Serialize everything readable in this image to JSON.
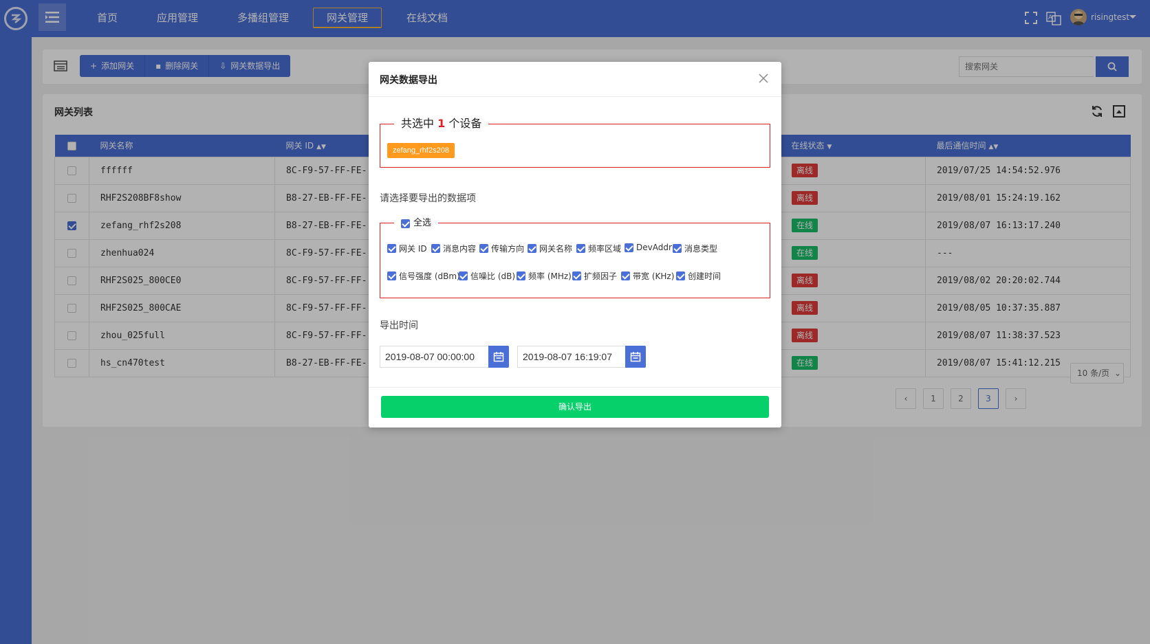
{
  "nav": {
    "items": [
      "首页",
      "应用管理",
      "多播组管理",
      "网关管理",
      "在线文档"
    ],
    "active_index": 3,
    "user_name": "risingtest"
  },
  "toolbar": {
    "add_label": "添加网关",
    "delete_label": "删除网关",
    "export_label": "网关数据导出",
    "search_placeholder": "搜索网关"
  },
  "table": {
    "title": "网关列表",
    "columns": {
      "name": "网关名称",
      "id": "网关 ID",
      "status": "在线状态",
      "last_time": "最后通信时间"
    },
    "rows": [
      {
        "checked": false,
        "name": "ffffff",
        "id": "8C-F9-57-FF-FE-",
        "status": "离线",
        "online": false,
        "last_time": "2019/07/25 14:54:52.976"
      },
      {
        "checked": false,
        "name": "RHF2S208BF8show",
        "id": "B8-27-EB-FF-FE-",
        "status": "离线",
        "online": false,
        "last_time": "2019/08/01 15:24:19.162"
      },
      {
        "checked": true,
        "name": "zefang_rhf2s208",
        "id": "B8-27-EB-FF-FE-",
        "status": "在线",
        "online": true,
        "last_time": "2019/08/07 16:13:17.240"
      },
      {
        "checked": false,
        "name": "zhenhua024",
        "id": "8C-F9-57-FF-FE-",
        "status": "在线",
        "online": true,
        "last_time": "---"
      },
      {
        "checked": false,
        "name": "RHF2S025_800CE0",
        "id": "8C-F9-57-FF-FF-",
        "status": "离线",
        "online": false,
        "last_time": "2019/08/02 20:20:02.744"
      },
      {
        "checked": false,
        "name": "RHF2S025_800CAE",
        "id": "8C-F9-57-FF-FF-",
        "status": "离线",
        "online": false,
        "last_time": "2019/08/05 10:37:35.887"
      },
      {
        "checked": false,
        "name": "zhou_025full",
        "id": "8C-F9-57-FF-FF-",
        "status": "离线",
        "online": false,
        "last_time": "2019/08/07 11:38:37.523"
      },
      {
        "checked": false,
        "name": "hs_cn470test",
        "id": "B8-27-EB-FF-FE-",
        "status": "在线",
        "online": true,
        "last_time": "2019/08/07 15:41:12.215"
      }
    ]
  },
  "pagination": {
    "prev": "‹",
    "pages": [
      "1",
      "2",
      "3"
    ],
    "current_page": "3",
    "next": "›",
    "page_size": "10 条/页"
  },
  "modal": {
    "title": "网关数据导出",
    "selected_prefix": "共选中",
    "selected_count": "1",
    "selected_suffix": "个设备",
    "selected_tag": "zefang_rhf2s208",
    "fields_label": "请选择要导出的数据项",
    "select_all": "全选",
    "options": [
      "网关 ID",
      "消息内容",
      "传输方向",
      "网关名称",
      "频率区域",
      "DevAddr",
      "消息类型",
      "信号强度 (dBm)",
      "信噪比 (dB)",
      "频率 (MHz)",
      "扩频因子",
      "带宽 (KHz)",
      "创建时间"
    ],
    "time_label": "导出时间",
    "start_time": "2019-08-07 00:00:00",
    "end_time": "2019-08-07 16:19:07",
    "confirm": "确认导出"
  },
  "colors": {
    "primary": "#4a6fd6",
    "offline": "#e03a3a",
    "online": "#19be6b",
    "tag": "#ff9a1f",
    "confirm": "#05d06a",
    "fieldset_border": "#e02020"
  }
}
